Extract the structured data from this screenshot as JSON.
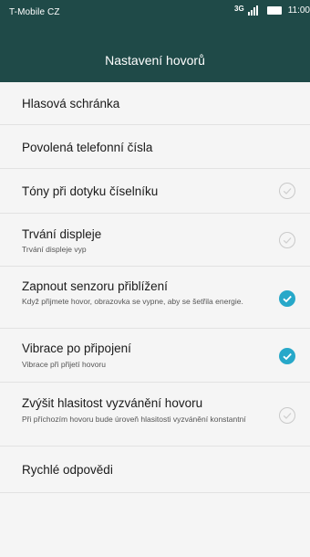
{
  "status_bar": {
    "carrier": "T-Mobile CZ",
    "network_type": "3G",
    "time": "11:00"
  },
  "header": {
    "title": "Nastavení hovorů"
  },
  "settings": [
    {
      "title": "Hlasová schránka"
    },
    {
      "title": "Povolená telefonní čísla"
    },
    {
      "title": "Tóny při dotyku číselníku",
      "checked": false
    },
    {
      "title": "Trvání displeje",
      "subtitle": "Trvání displeje vyp",
      "checked": false
    },
    {
      "title": "Zapnout senzoru přiblížení",
      "subtitle": "Když přijmete hovor, obrazovka se vypne, aby se šetřila energie.",
      "checked": true
    },
    {
      "title": "Vibrace po připojení",
      "subtitle": "Vibrace při přijetí hovoru",
      "checked": true
    },
    {
      "title": "Zvýšit hlasitost vyzvánění hovoru",
      "subtitle": "Při příchozím hovoru bude úroveň hlasitosti vyzvánění konstantní",
      "checked": false
    },
    {
      "title": "Rychlé odpovědi"
    }
  ],
  "colors": {
    "header_bg": "#1f4a48",
    "accent": "#27a8c9",
    "list_bg": "#f5f5f5"
  }
}
